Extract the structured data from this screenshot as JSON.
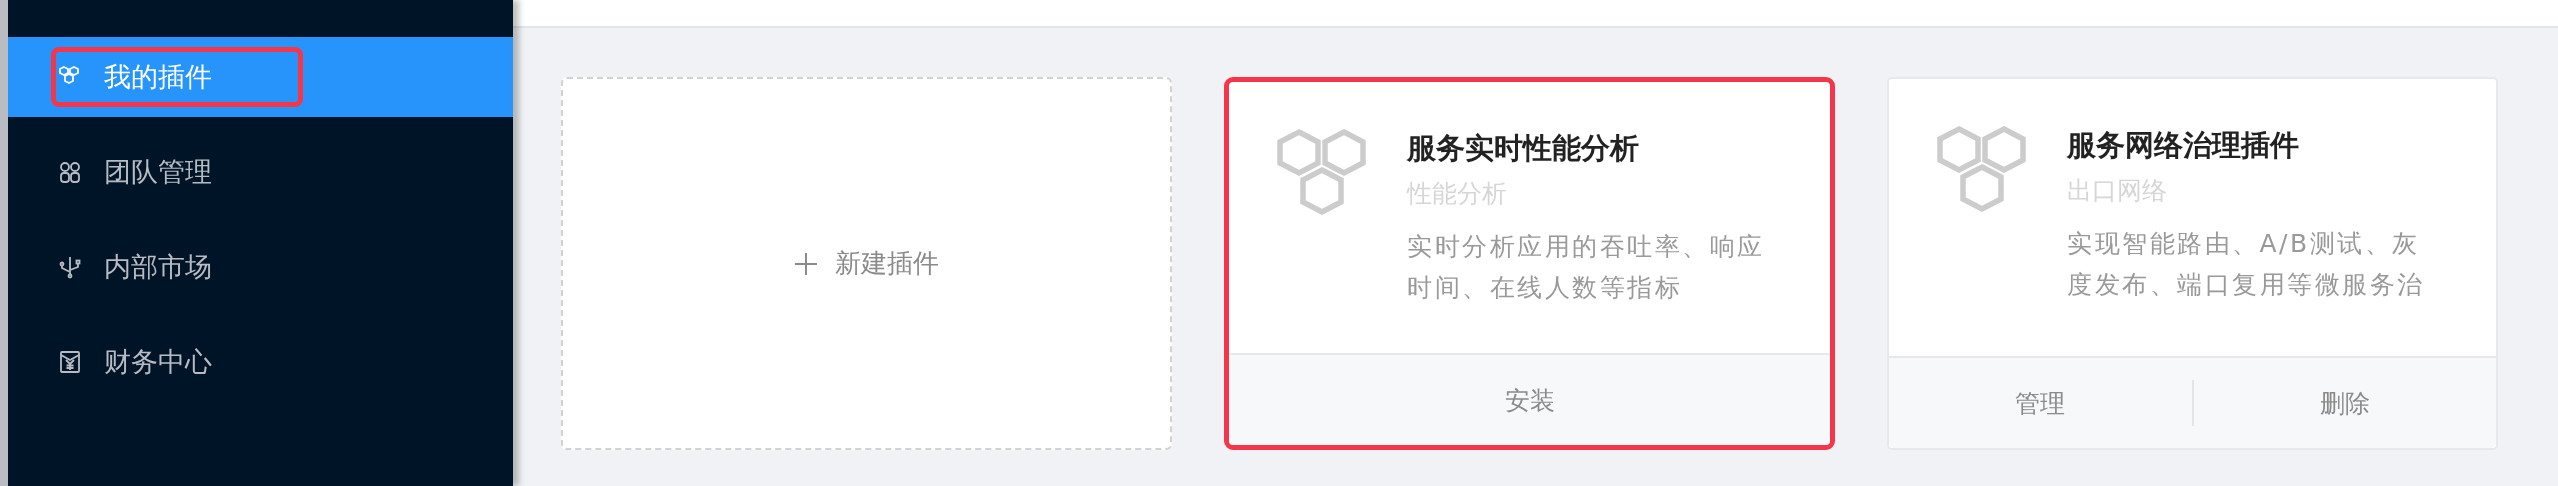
{
  "sidebar": {
    "items": [
      {
        "label": "我的插件",
        "kind": "plugin",
        "selected": true,
        "highlighted": true
      },
      {
        "label": "团队管理",
        "kind": "team",
        "selected": false,
        "highlighted": false
      },
      {
        "label": "内部市场",
        "kind": "usb",
        "selected": false,
        "highlighted": false
      },
      {
        "label": "财务中心",
        "kind": "finance",
        "selected": false,
        "highlighted": false
      }
    ]
  },
  "new_plugin": {
    "label": "新建插件"
  },
  "plugins": [
    {
      "title": "服务实时性能分析",
      "category": "性能分析",
      "description": "实时分析应用的吞吐率、响应时间、在线人数等指标",
      "highlighted": true,
      "actions": [
        {
          "label": "安装"
        }
      ]
    },
    {
      "title": "服务网络治理插件",
      "category": "出口网络",
      "description": "实现智能路由、A/B测试、灰度发布、端口复用等微服务治",
      "highlighted": false,
      "actions": [
        {
          "label": "管理"
        },
        {
          "label": "删除"
        }
      ]
    }
  ]
}
